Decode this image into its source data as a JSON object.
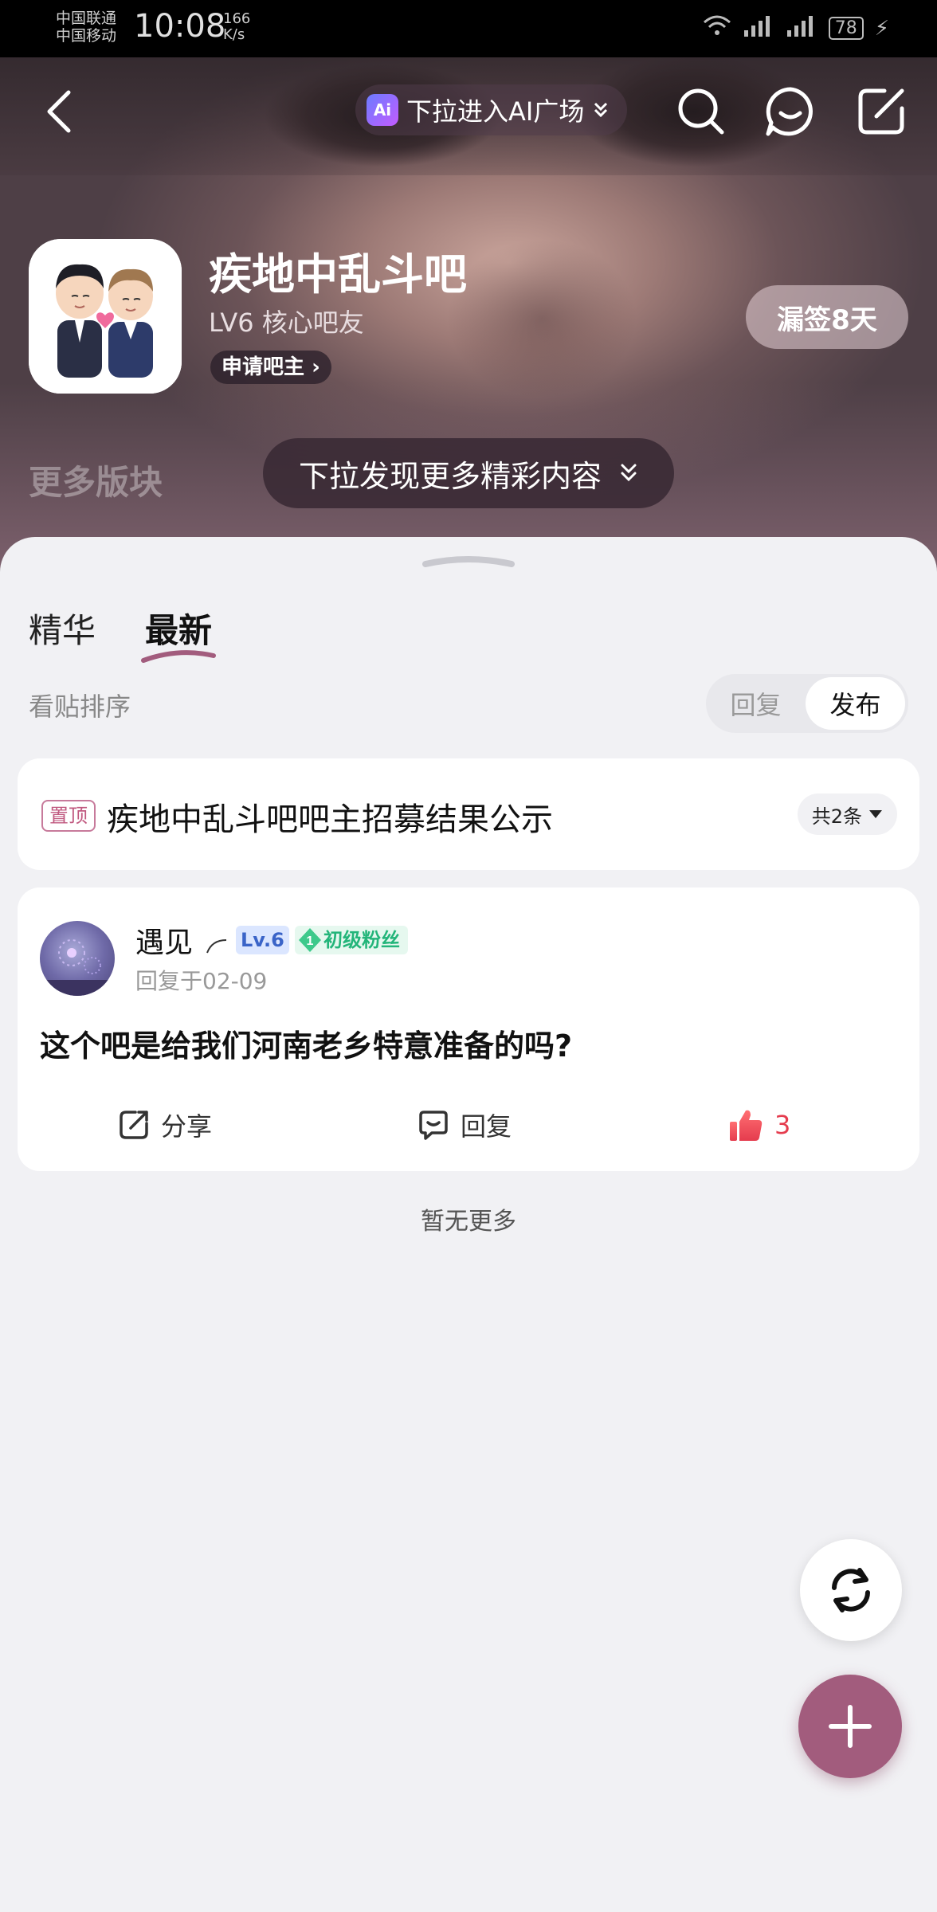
{
  "status_bar": {
    "carrier_line1": "中国联通",
    "carrier_line2": "中国移动",
    "time": "10:08",
    "speed_value": "166",
    "speed_unit": "K/s",
    "battery": "78"
  },
  "top_bar": {
    "ai_logo": "Ai",
    "ai_plaza_label": "下拉进入AI广场"
  },
  "forum": {
    "name": "疾地中乱斗吧",
    "level": "LV6 核心吧友",
    "apply_label": "申请吧主",
    "sign_label": "漏签8天"
  },
  "more_board_label": "更多版块",
  "discover_label": "下拉发现更多精彩内容",
  "tabs": [
    {
      "label": "精华"
    },
    {
      "label": "最新"
    }
  ],
  "sort": {
    "label": "看贴排序",
    "options": [
      "回复",
      "发布"
    ],
    "selected": "发布"
  },
  "pinned": {
    "badge": "置顶",
    "title": "疾地中乱斗吧吧主招募结果公示",
    "count": "共2条"
  },
  "post": {
    "username": "遇见",
    "level_tag": "Lv.6",
    "fan_level": "1",
    "fan_tag": "初级粉丝",
    "reply_time": "回复于02-09",
    "title": "这个吧是给我们河南老乡特意准备的吗?",
    "share_label": "分享",
    "reply_label": "回复",
    "like_count": "3"
  },
  "no_more_label": "暂无更多",
  "colors": {
    "accent": "#a25c7d",
    "like_red": "#e53c4e",
    "fan_green": "#23b57a",
    "level_blue": "#3a64c8",
    "pin_pink": "#c0587f"
  }
}
